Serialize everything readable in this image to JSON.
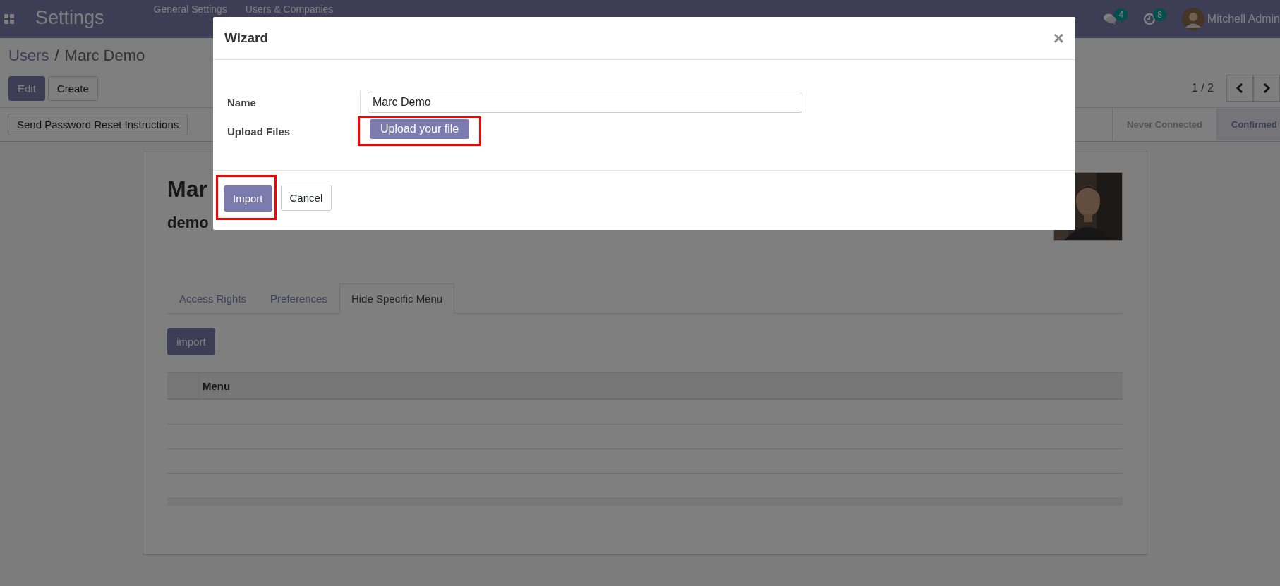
{
  "navbar": {
    "app": "Settings",
    "menus": [
      "General Settings",
      "Users & Companies"
    ],
    "messages_badge": "4",
    "activities_badge": "8",
    "user": "Mitchell Admin"
  },
  "breadcrumb_separator": "/",
  "breadcrumb": [
    {
      "label": "Users",
      "kind": "link"
    },
    {
      "label": "Marc Demo",
      "kind": "current"
    }
  ],
  "actions": [
    {
      "label": "Edit",
      "kind": "primary"
    },
    {
      "label": "Create",
      "kind": "secondary"
    }
  ],
  "pager": "1 / 2",
  "header_buttons": [
    "Send Password Reset Instructions"
  ],
  "statusbar": [
    {
      "label": "Never Connected",
      "selected": false
    },
    {
      "label": "Confirmed",
      "selected": true
    }
  ],
  "sheet": {
    "name": "Mar",
    "login": "demo",
    "tabs": [
      {
        "label": "Access Rights",
        "selected": false
      },
      {
        "label": "Preferences",
        "selected": false
      },
      {
        "label": "Hide Specific Menu",
        "selected": true
      }
    ],
    "import_button": "import",
    "table": {
      "columns": [
        "Menu"
      ]
    }
  },
  "modal": {
    "title": "Wizard",
    "close": "×",
    "fields": [
      {
        "label": "Name",
        "kind": "input",
        "value": "Marc Demo"
      },
      {
        "label": "Upload Files",
        "kind": "upload",
        "button": "Upload your file",
        "highlighted": true
      }
    ],
    "buttons": [
      {
        "label": "Import",
        "kind": "primary",
        "highlighted": true
      },
      {
        "label": "Cancel",
        "kind": "secondary",
        "highlighted": false
      }
    ]
  }
}
